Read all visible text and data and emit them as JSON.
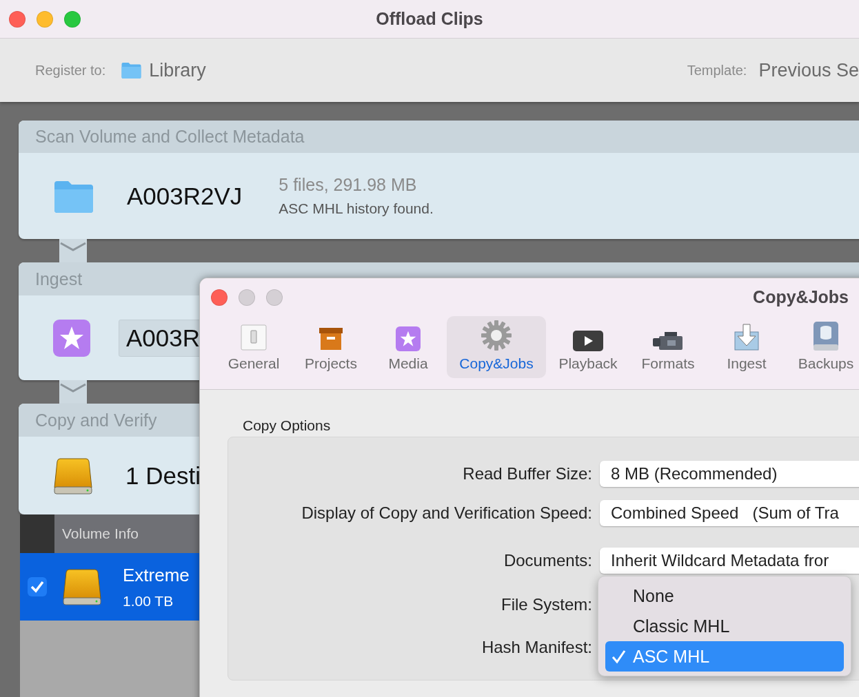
{
  "window": {
    "title": "Offload Clips"
  },
  "toolbar": {
    "register_label": "Register to:",
    "register_value": "Library",
    "template_label": "Template:",
    "template_value": "Previous Se"
  },
  "steps": [
    {
      "kind": "scan",
      "title": "Scan Volume and Collect Metadata",
      "name": "A003R2VJ",
      "summary": "5 files, 291.98 MB",
      "note": "ASC MHL history found."
    },
    {
      "kind": "ingest",
      "title": "Ingest",
      "name": "A003R"
    },
    {
      "kind": "copy",
      "title": "Copy and Verify",
      "name": "1 Desti"
    }
  ],
  "volume_info": {
    "header": "Volume Info",
    "volumes": [
      {
        "name": "Extreme",
        "size": "1.00 TB",
        "checked": true,
        "selected": true
      }
    ]
  },
  "preferences": {
    "title": "Copy&Jobs",
    "tabs": [
      {
        "kind": "general",
        "label": "General",
        "selected": false
      },
      {
        "kind": "projects",
        "label": "Projects",
        "selected": false
      },
      {
        "kind": "media",
        "label": "Media",
        "selected": false
      },
      {
        "kind": "jobs",
        "label": "Copy&Jobs",
        "selected": true
      },
      {
        "kind": "playback",
        "label": "Playback",
        "selected": false
      },
      {
        "kind": "formats",
        "label": "Formats",
        "selected": false
      },
      {
        "kind": "ingest",
        "label": "Ingest",
        "selected": false
      },
      {
        "kind": "backups",
        "label": "Backups",
        "selected": false
      }
    ],
    "section": "Copy Options",
    "fields": [
      {
        "label": "Read Buffer Size:",
        "value": "8 MB (Recommended)"
      },
      {
        "label": "Display of Copy and Verification Speed:",
        "value": "Combined Speed   (Sum of Tra"
      },
      {
        "label": "Documents:",
        "value": "Inherit Wildcard Metadata fror"
      },
      {
        "label": "File System:"
      },
      {
        "label": "Hash Manifest:"
      }
    ],
    "menu": [
      {
        "label": "None",
        "selected": false
      },
      {
        "label": "Classic MHL",
        "selected": false
      },
      {
        "label": "ASC MHL",
        "selected": true
      }
    ]
  }
}
